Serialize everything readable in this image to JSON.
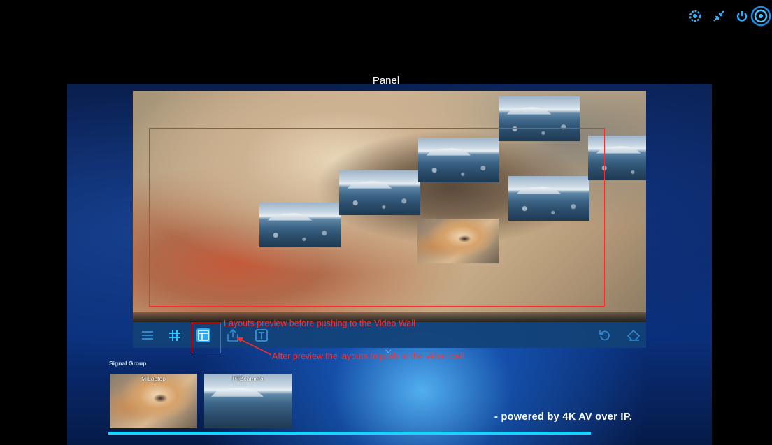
{
  "header": {
    "icons": [
      "gear-icon",
      "shrink-icon",
      "power-icon",
      "dial-icon"
    ]
  },
  "panel": {
    "title": "Panel"
  },
  "preview": {
    "tiles": [
      {
        "source": "PTZcamera"
      },
      {
        "source": "PTZcamera"
      },
      {
        "source": "PTZcamera"
      },
      {
        "source": "PTZcamera"
      },
      {
        "source": "PTZcamera"
      },
      {
        "source": "PTZcamera"
      },
      {
        "source": "MiLaptop"
      }
    ]
  },
  "toolbar": {
    "items": [
      {
        "icon": "menu-icon"
      },
      {
        "icon": "grid-icon"
      },
      {
        "icon": "layout-icon",
        "active": true
      },
      {
        "icon": "push-icon"
      },
      {
        "icon": "text-icon"
      },
      {
        "icon": "undo-icon"
      },
      {
        "icon": "eraser-icon"
      }
    ]
  },
  "annotations": {
    "layout_note": "Layouts preview before pushing to the Video Wall",
    "push_note": "After preview the layouts to push to the video wall"
  },
  "signal_group": {
    "label": "Signal Group",
    "sources": [
      {
        "name": "MiLaptop"
      },
      {
        "name": "PTZcamera"
      }
    ]
  },
  "footer": {
    "tagline": "- powered by 4K AV over IP.",
    "progress": 1.0
  },
  "colors": {
    "accent": "#19d3ff",
    "annotation": "#ff2a2a",
    "toolbar": "#124276"
  }
}
